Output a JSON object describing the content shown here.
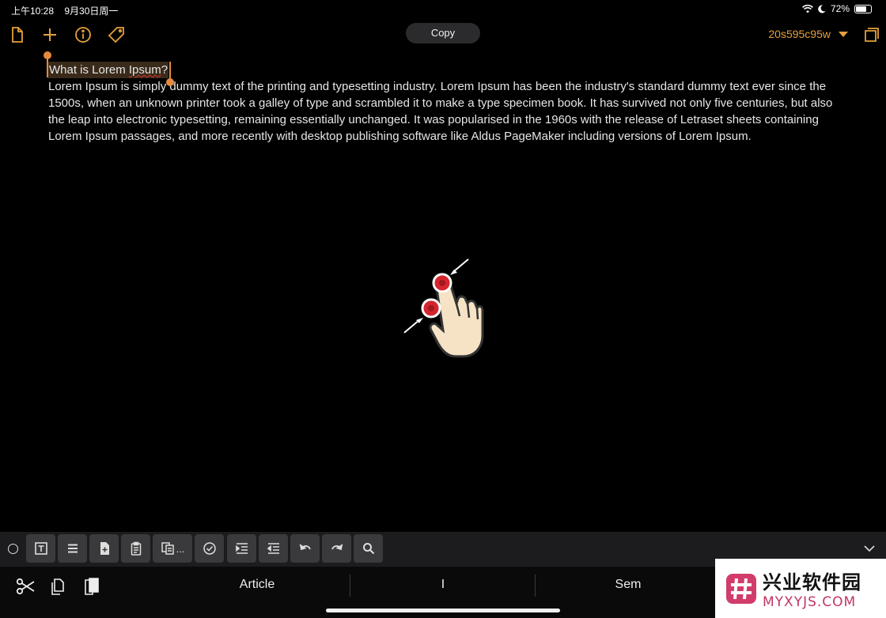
{
  "status": {
    "time": "上午10:28",
    "date": "9月30日周一",
    "battery": "72%",
    "battery_level": 0.72
  },
  "toolbar": {
    "icons": [
      "document-icon",
      "plus-icon",
      "info-icon",
      "tag-icon"
    ],
    "copy_label": "Copy",
    "doc_name": "20s595c95w",
    "accent": "#e5a13b"
  },
  "document": {
    "heading_pre": "What is Lorem ",
    "heading_misspelled": "Ipsum",
    "heading_post": "?",
    "body": "Lorem Ipsum is simply dummy text of the printing and typesetting industry. Lorem Ipsum has been the industry's standard dummy text ever since the 1500s, when an unknown printer took a galley of type and scrambled it to make a type specimen book. It has survived not only five centuries, but also the leap into electronic typesetting, remaining essentially unchanged. It was popularised in the 1960s with the release of Letraset sheets containing Lorem Ipsum passages, and more recently with desktop publishing software like Aldus PageMaker including versions of Lorem Ipsum."
  },
  "format_bar": {
    "buttons": [
      "text-format-icon",
      "list-icon",
      "new-file-icon",
      "clipboard-icon",
      "copy-more-icon",
      "checkbox-icon",
      "indent-icon",
      "outdent-icon",
      "undo-icon",
      "redo-icon",
      "search-icon"
    ],
    "copy_more_suffix": "..."
  },
  "keyboard": {
    "suggestions": [
      "Article",
      "I",
      "Sem"
    ]
  },
  "watermark": {
    "cn": "兴业软件园",
    "en": "MYXYJS.COM"
  }
}
